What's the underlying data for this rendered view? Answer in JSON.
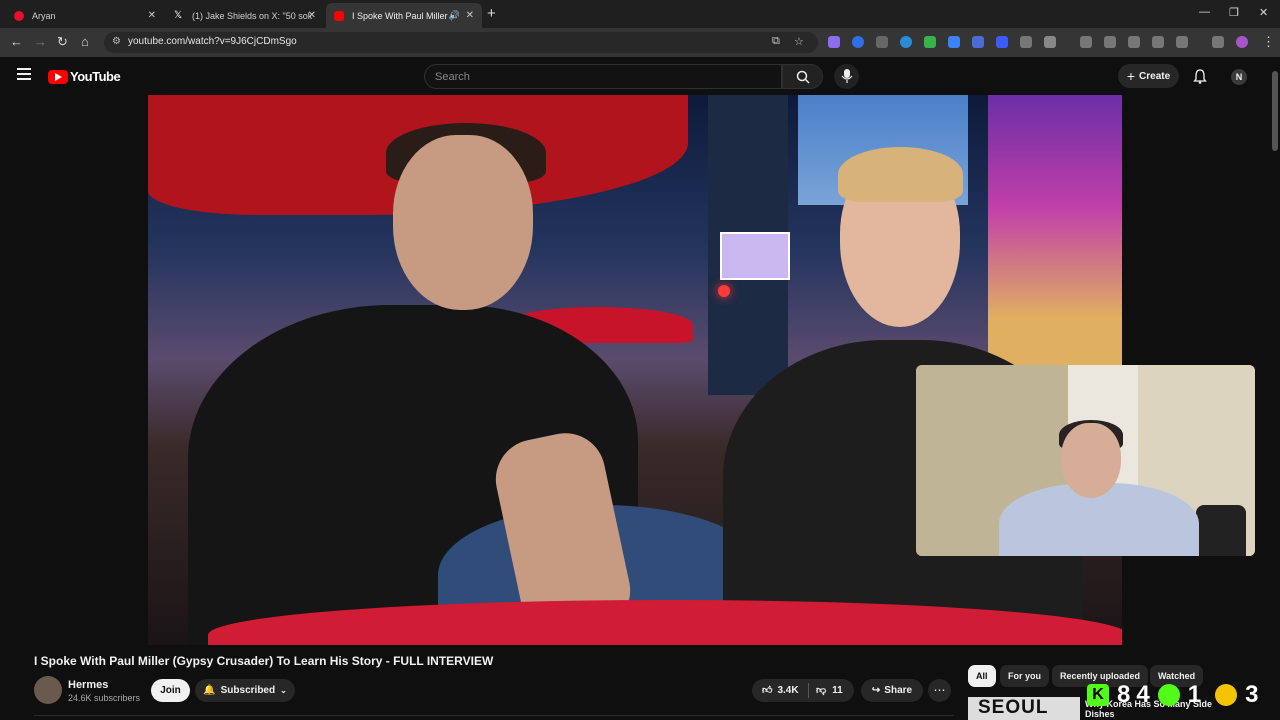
{
  "browser": {
    "tabs": [
      {
        "label": "Aryan",
        "favicon_color": "#e81123",
        "active": false
      },
      {
        "label": "(1) Jake Shields on X: \"50 sold i",
        "favicon_color": "#ffffff",
        "active": false
      },
      {
        "label": "I Spoke With Paul Miller (Gy",
        "favicon_color": "#ff0000",
        "active": true
      }
    ],
    "new_tab_icon": "+",
    "url_host": "youtube.com",
    "url_path": "/watch?v=9J6CjCDmSgo",
    "url_full": "youtube.com/watch?v=9J6CjCDmSgo"
  },
  "youtube": {
    "logo_text": "YouTube",
    "search_placeholder": "Search",
    "create_label": "Create",
    "avatar_letter": "N"
  },
  "video": {
    "title": "I Spoke With Paul Miller (Gypsy Crusader) To Learn His Story - FULL INTERVIEW",
    "channel_name": "Hermes",
    "subscribers": "24.6K subscribers",
    "join_label": "Join",
    "subscribed_label": "Subscribed",
    "likes": "3.4K",
    "dislikes": "11",
    "share_label": "Share"
  },
  "chips": [
    "All",
    "For you",
    "Recently uploaded",
    "Watched"
  ],
  "recommendation": {
    "thumb_text": "SEOUL",
    "title": "Why Korea Has So Many Side Dishes"
  },
  "scoreboard": {
    "k": "8",
    "k2": "4",
    "p": "1",
    "c": "3"
  },
  "colors": {
    "accent_red": "#ff0000",
    "background": "#0f0f0f",
    "kick_green": "#53fc18"
  }
}
